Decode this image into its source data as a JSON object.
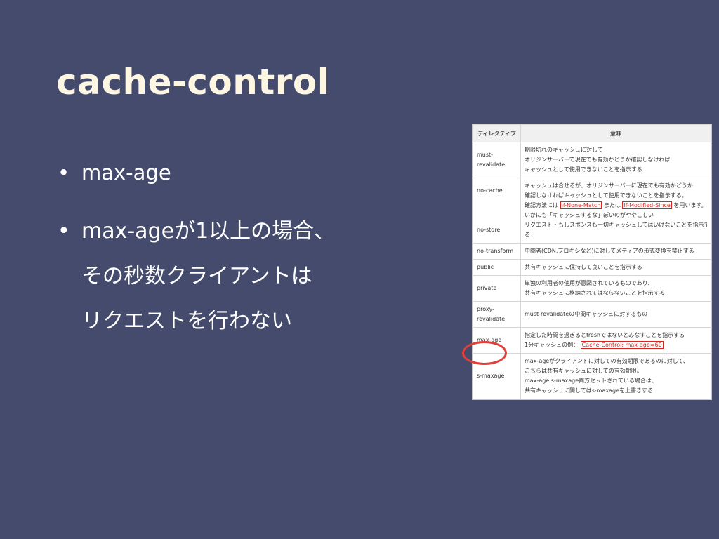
{
  "title": "cache-control",
  "bullets": [
    {
      "text": "max-age"
    },
    {
      "lines": [
        "max-ageが1以上の場合、",
        "その秒数クライアントは",
        "リクエストを行わない"
      ]
    }
  ],
  "table": {
    "headers": [
      "ディレクティブ",
      "意味"
    ],
    "rows": [
      {
        "directive": "must-revalidate",
        "lines": [
          "期限切れのキャッシュに対して",
          "オリジンサーバーで現在でも有効かどうか確認しなければ",
          "キャッシュとして使用できないことを指示する"
        ]
      },
      {
        "directive": "no-cache",
        "lines": [
          "キャッシュは合せるが、オリジンサーバーに現在でも有効かどうか",
          "確認しなければキャッシュとして使用できないことを指示する。",
          "確認方法には If-None-Match または If-Modified-Since を用います。",
          "いかにも「キャッシュするな」ぽいのがややこしい"
        ]
      },
      {
        "directive": "no-store",
        "lines": [
          "リクエスト・もしスポンスも一切キャッシュしてはいけないことを指示す",
          "る"
        ]
      },
      {
        "directive": "no-transform",
        "lines": [
          "中間者(CDN,プロキシなど)に対してメディアの形式変換を禁止する"
        ]
      },
      {
        "directive": "public",
        "lines": [
          "共有キャッシュに保持して良いことを指示する"
        ]
      },
      {
        "directive": "private",
        "lines": [
          "単独の利用者の使用が意図されているものであり、",
          "共有キャッシュに格納されてはならないことを指示する"
        ]
      },
      {
        "directive": "proxy-revalidate",
        "lines": [
          "must-revalidateの中間キャッシュに対するもの"
        ]
      },
      {
        "directive": "max-age",
        "lines": [
          "指定した時間を過ぎるとfreshではないとみなすことを指示する",
          "1分キャッシュの例： Cache-Control: max-age=60"
        ]
      },
      {
        "directive": "s-maxage",
        "lines": [
          "max-ageがクライアントに対しての有効期限であるのに対して、",
          "こちらは共有キャッシュに対しての有効期限。",
          "max-age,s-maxage両方セットされている場合は、",
          "共有キャッシュに関してはs-maxageを上書きする"
        ]
      }
    ]
  },
  "highlights": {
    "if_none_match": "If-None-Match",
    "if_modified_since": "If-Modified-Since",
    "cache_control_example": "Cache-Control: max-age=60"
  },
  "colors": {
    "background": "#454b6c",
    "title": "#fdf6e3",
    "highlight": "#d8261e",
    "circle": "#e0403a"
  }
}
